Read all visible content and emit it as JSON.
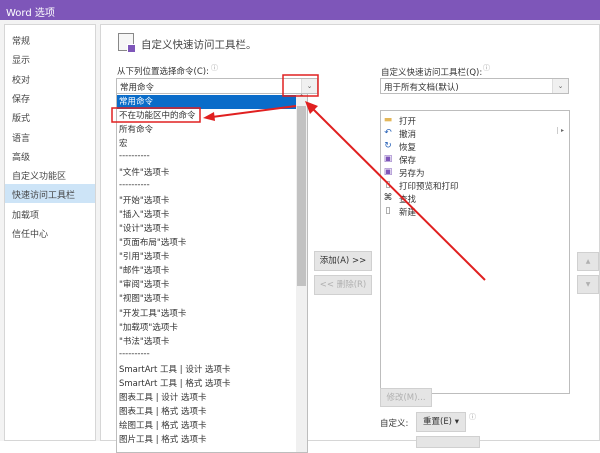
{
  "window": {
    "title": "Word 选项"
  },
  "sidebar": {
    "items": [
      {
        "label": "常规"
      },
      {
        "label": "显示"
      },
      {
        "label": "校对"
      },
      {
        "label": "保存"
      },
      {
        "label": "版式"
      },
      {
        "label": "语言"
      },
      {
        "label": "高级"
      },
      {
        "label": "自定义功能区"
      },
      {
        "label": "快速访问工具栏",
        "selected": true
      },
      {
        "label": "加载项"
      },
      {
        "label": "信任中心"
      }
    ]
  },
  "main": {
    "heading": "自定义快速访问工具栏。",
    "choose_label": "从下列位置选择命令(C):",
    "choose_value": "常用命令",
    "choose_options": [
      "常用命令",
      "不在功能区中的命令",
      "所有命令",
      "宏",
      "----------",
      "\"文件\"选项卡",
      "----------",
      "\"开始\"选项卡",
      "\"插入\"选项卡",
      "\"设计\"选项卡",
      "\"页面布局\"选项卡",
      "\"引用\"选项卡",
      "\"邮件\"选项卡",
      "\"审阅\"选项卡",
      "\"视图\"选项卡",
      "\"开发工具\"选项卡",
      "\"加载项\"选项卡",
      "\"书法\"选项卡",
      "----------",
      "SmartArt 工具 | 设计 选项卡",
      "SmartArt 工具 | 格式 选项卡",
      "图表工具 | 设计 选项卡",
      "图表工具 | 格式 选项卡",
      "绘图工具 | 格式 选项卡",
      "图片工具 | 格式 选项卡"
    ],
    "qat_label": "自定义快速访问工具栏(Q):",
    "qat_value": "用于所有文档(默认)",
    "qat_items": [
      {
        "label": "打开",
        "icon": "folder-open"
      },
      {
        "label": "撤消",
        "icon": "undo"
      },
      {
        "label": "恢复",
        "icon": "redo"
      },
      {
        "label": "保存",
        "icon": "save"
      },
      {
        "label": "另存为",
        "icon": "save-as"
      },
      {
        "label": "打印预览和打印",
        "icon": "print-preview"
      },
      {
        "label": "查找",
        "icon": "binoculars"
      },
      {
        "label": "新建",
        "icon": "new-document"
      }
    ],
    "add_button": "添加(A) >>",
    "remove_button": "<< 删除(R)",
    "modify_button": "修改(M)...",
    "customize_label": "自定义:",
    "reset_button": "重置(E) ▾"
  },
  "colors": {
    "titlebar": "#7e56b9",
    "selection": "#0a6cc9",
    "annotation": "#e02020"
  }
}
